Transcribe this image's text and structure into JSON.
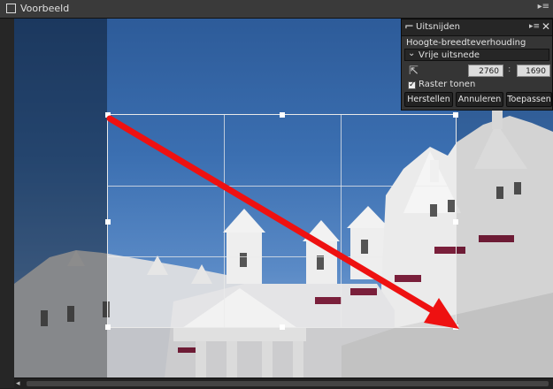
{
  "window": {
    "title": "Voorbeeld"
  },
  "crop_panel": {
    "title": "Uitsnijden",
    "aspect_label": "Hoogte-breedteverhouding",
    "aspect_value": "Vrije uitsnede",
    "width": "2760",
    "separator": ":",
    "height": "1690",
    "show_grid_label": "Raster tonen",
    "show_grid_checked": true,
    "buttons": {
      "reset": "Herstellen",
      "cancel": "Annuleren",
      "apply": "Toepassen"
    }
  },
  "icons": {
    "panel": "crop-icon",
    "panel_menu": "panel-menu-icon",
    "close": "close-icon",
    "ratio": "rotate-ratio-icon",
    "arrow": "annotation-arrow-icon"
  },
  "colors": {
    "arrow": "#ee1111",
    "sky": "#3b6fb1",
    "building": "#e8e8e8"
  }
}
